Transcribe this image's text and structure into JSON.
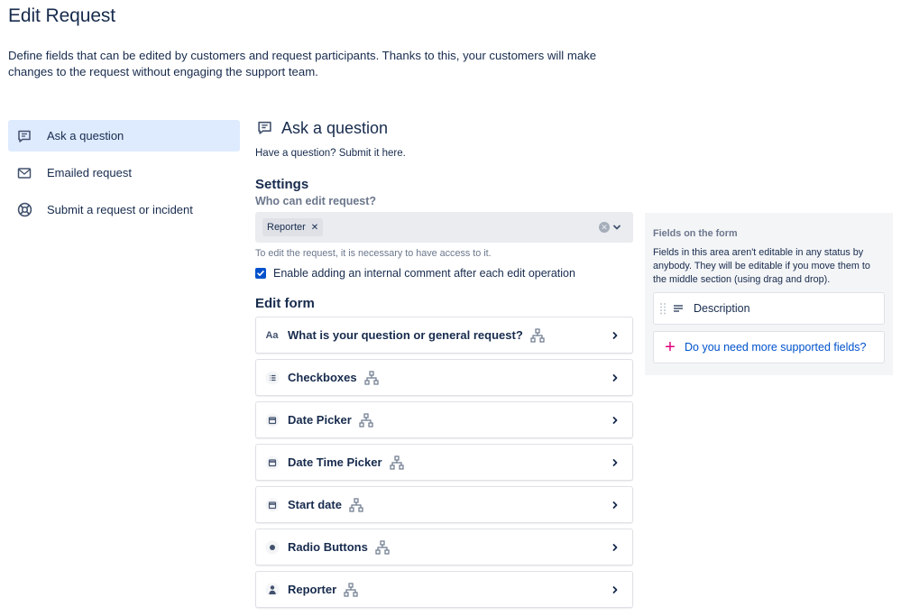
{
  "page": {
    "title": "Edit Request",
    "description": "Define fields that can be edited by customers and request participants. Thanks to this, your customers will make changes to the request without engaging the support team."
  },
  "nav": {
    "items": [
      {
        "label": "Ask a question",
        "icon": "speech-bubble-icon",
        "active": true
      },
      {
        "label": "Emailed request",
        "icon": "envelope-icon",
        "active": false
      },
      {
        "label": "Submit a request or incident",
        "icon": "lifebuoy-icon",
        "active": false
      }
    ]
  },
  "request_type": {
    "title": "Ask a question",
    "subtitle": "Have a question? Submit it here."
  },
  "settings": {
    "title": "Settings",
    "who_label": "Who can edit request?",
    "selected_tag": "Reporter",
    "helper": "To edit the request, it is necessary to have access to it.",
    "internal_comment_label": "Enable adding an internal comment after each edit operation",
    "internal_comment_checked": true
  },
  "edit_form": {
    "title": "Edit form",
    "fields": [
      {
        "label": "What is your question or general request?",
        "icon": "text-field-icon"
      },
      {
        "label": "Checkboxes",
        "icon": "checklist-icon"
      },
      {
        "label": "Date Picker",
        "icon": "calendar-icon"
      },
      {
        "label": "Date Time Picker",
        "icon": "calendar-icon"
      },
      {
        "label": "Start date",
        "icon": "calendar-icon"
      },
      {
        "label": "Radio Buttons",
        "icon": "radio-icon"
      },
      {
        "label": "Reporter",
        "icon": "person-icon"
      }
    ]
  },
  "side_panel": {
    "title": "Fields on the form",
    "description": "Fields in this area aren't editable in any status by anybody. They will be editable if you move them to the middle section (using drag and drop).",
    "field_label": "Description",
    "add_label": "Do you need more supported fields?"
  },
  "text_icon_glyph": "Aa",
  "colors": {
    "accent": "#0052cc",
    "active_bg": "#deebff",
    "panel_bg": "#f4f5f7",
    "text": "#172b4d",
    "muted": "#6b778c",
    "plus": "#e2007a"
  }
}
